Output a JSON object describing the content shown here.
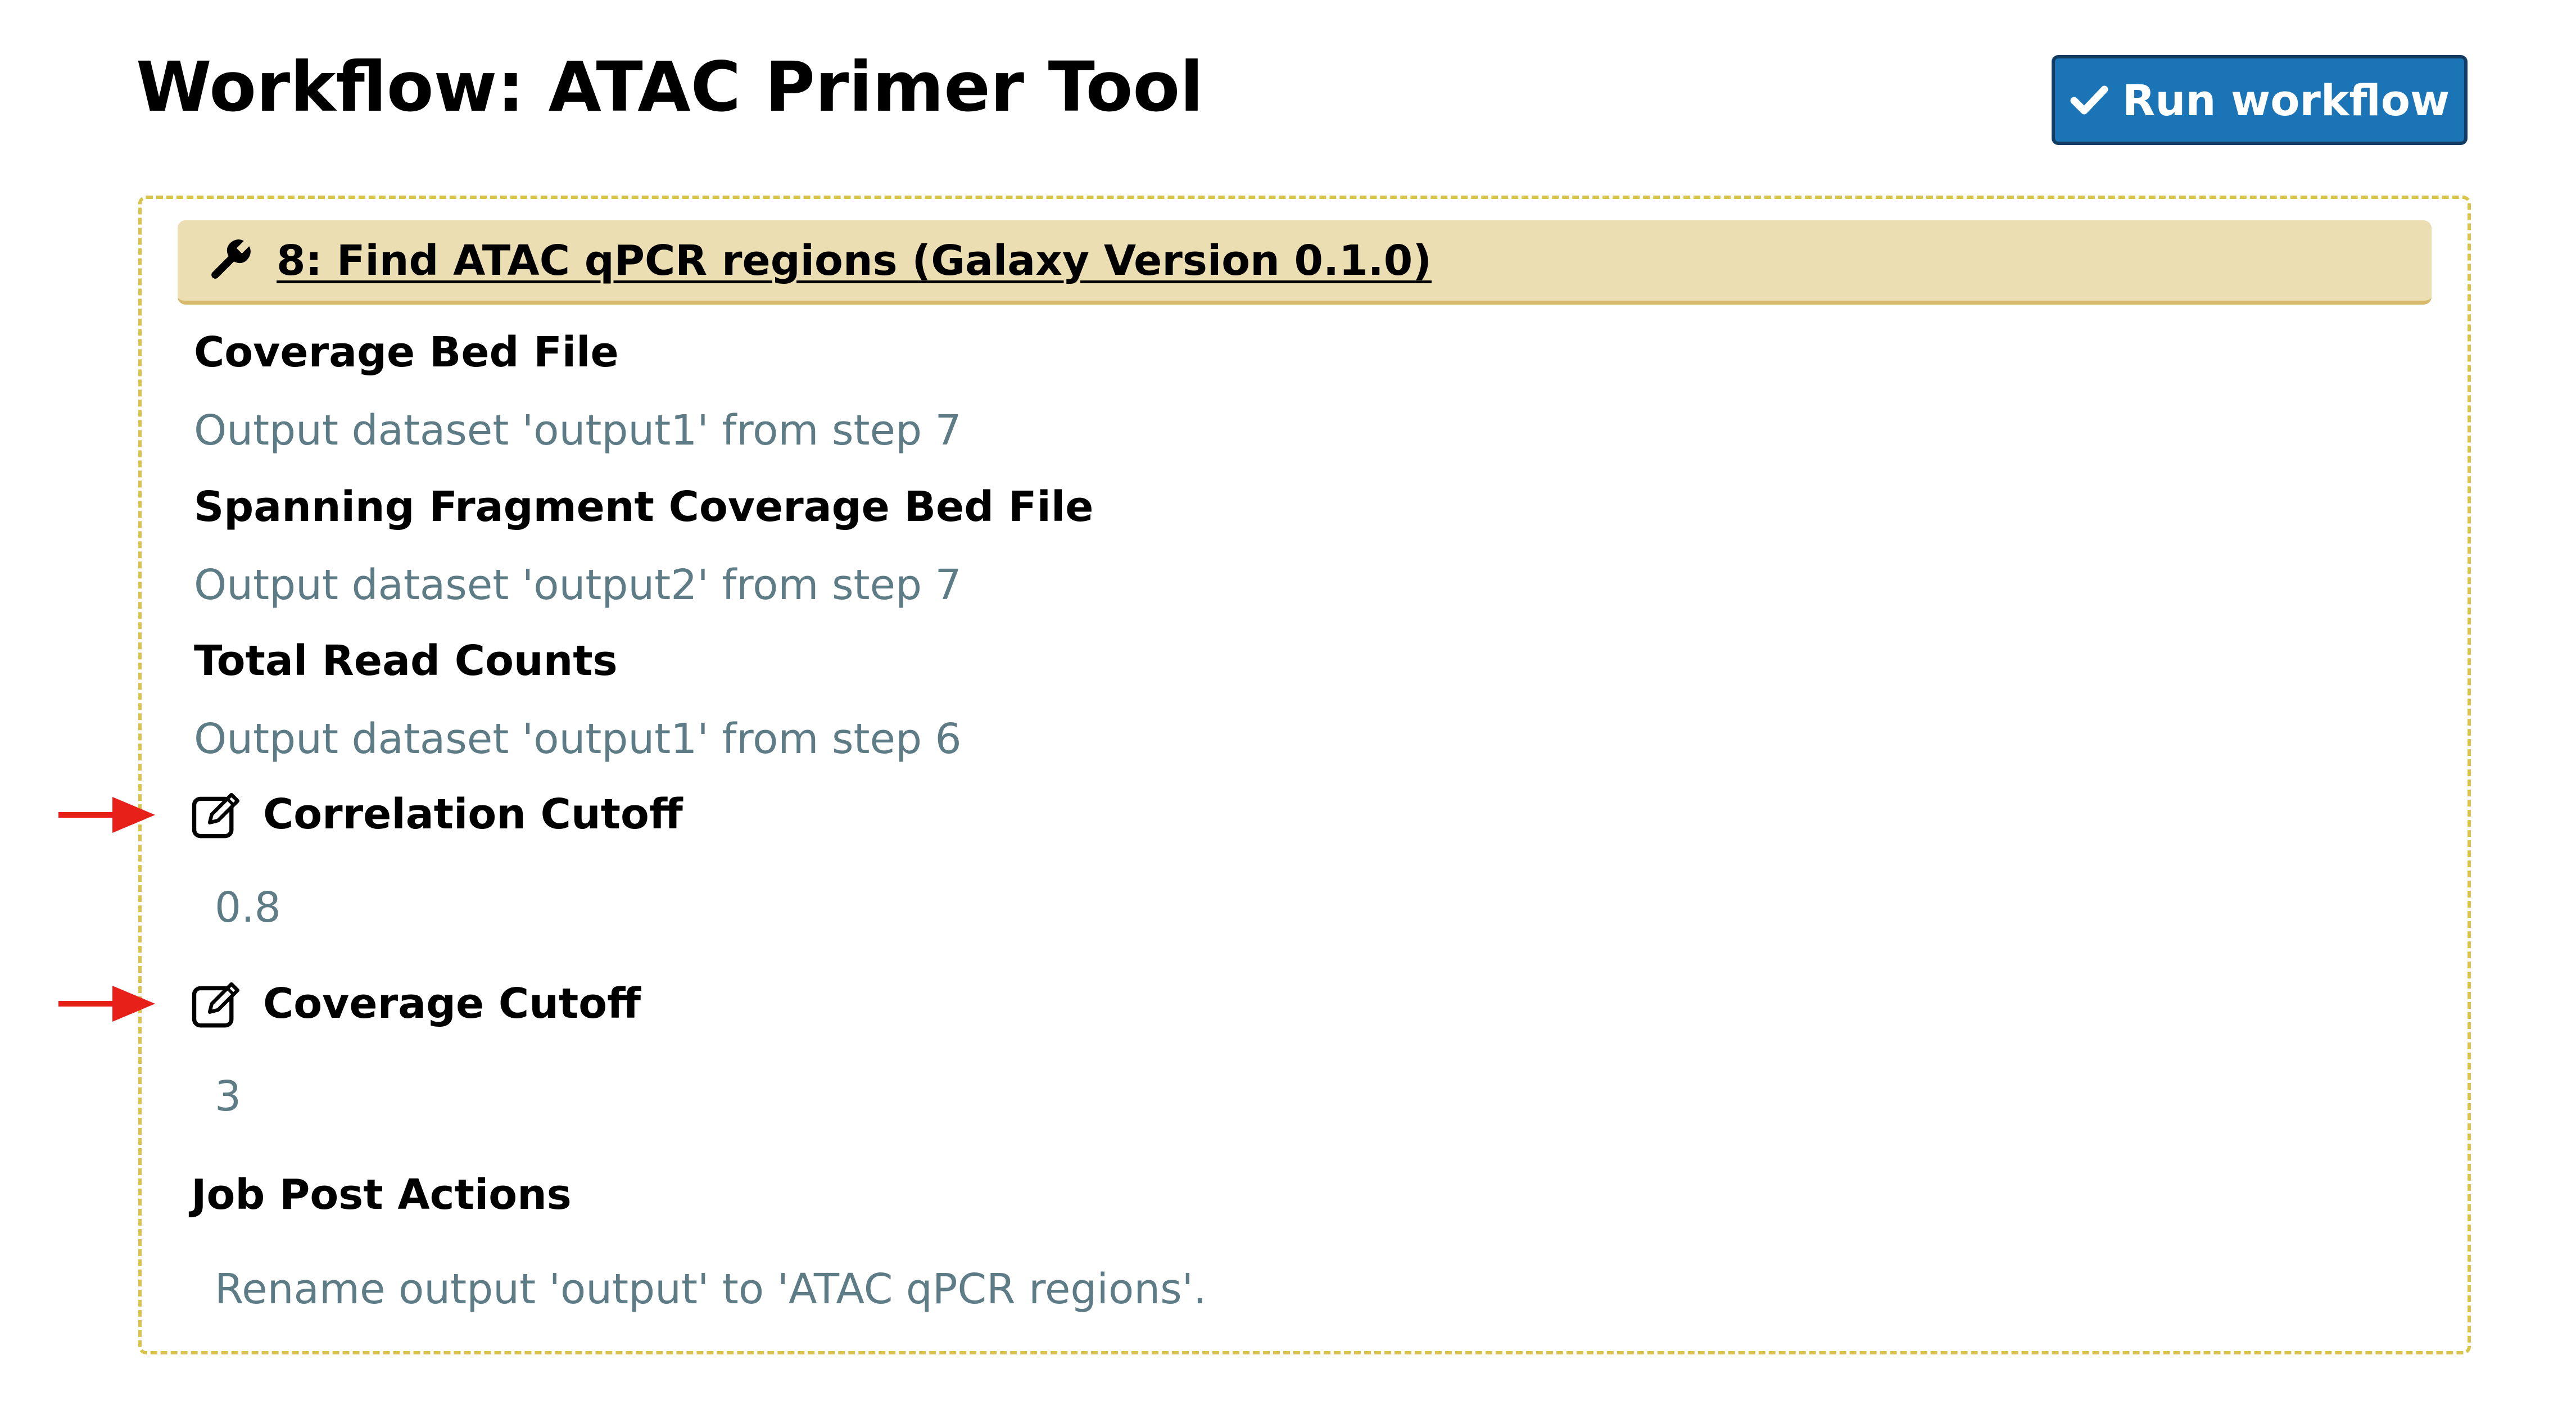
{
  "page": {
    "title": "Workflow: ATAC Primer Tool"
  },
  "toolbar": {
    "run_label": "Run workflow",
    "run_icon": "check-icon"
  },
  "step": {
    "icon": "wrench-icon",
    "title": "8: Find ATAC qPCR regions (Galaxy Version 0.1.0)",
    "params": [
      {
        "label": "Coverage Bed File",
        "value": "Output dataset 'output1' from step 7",
        "editable": false
      },
      {
        "label": "Spanning Fragment Coverage Bed File",
        "value": "Output dataset 'output2' from step 7",
        "editable": false
      },
      {
        "label": "Total Read Counts",
        "value": "Output dataset 'output1' from step 6",
        "editable": false
      },
      {
        "label": "Correlation Cutoff",
        "value": "0.8",
        "editable": true,
        "icon": "edit-icon",
        "annotation": "red-arrow-icon"
      },
      {
        "label": "Coverage Cutoff",
        "value": "3",
        "editable": true,
        "icon": "edit-icon",
        "annotation": "red-arrow-icon"
      }
    ],
    "post_actions": {
      "label": "Job Post Actions",
      "value": "Rename output 'output' to 'ATAC qPCR regions'."
    }
  },
  "colors": {
    "button_bg": "#1a74b6",
    "button_border": "#123c63",
    "header_bg": "#ecdeb3",
    "header_border": "#d6b96a",
    "panel_border": "#d8c44a",
    "value_text": "#5d7c86",
    "annotation_arrow": "#e8201a"
  }
}
